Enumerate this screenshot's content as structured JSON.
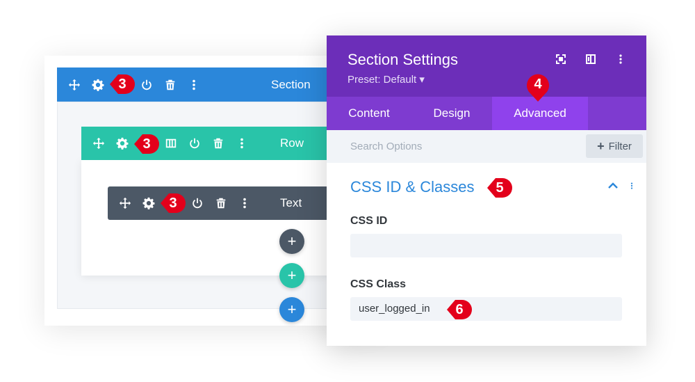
{
  "builder": {
    "section_label": "Section",
    "row_label": "Row",
    "module_label": "Text"
  },
  "badges": {
    "section": "3",
    "row": "3",
    "module": "3",
    "advanced_tab": "4",
    "css_group": "5",
    "css_class": "6"
  },
  "modal": {
    "title": "Section Settings",
    "preset": "Preset: Default ▾",
    "tabs": [
      "Content",
      "Design",
      "Advanced"
    ],
    "active_tab": "Advanced",
    "search_placeholder": "Search Options",
    "filter_label": "Filter",
    "group_title": "CSS ID & Classes",
    "css_id_label": "CSS ID",
    "css_id_value": "",
    "css_class_label": "CSS Class",
    "css_class_value": "user_logged_in"
  },
  "colors": {
    "section": "#2b87da",
    "row": "#29c4a9",
    "module": "#4c5866",
    "modal_header": "#6c2eb9",
    "badge": "#e3001b"
  }
}
